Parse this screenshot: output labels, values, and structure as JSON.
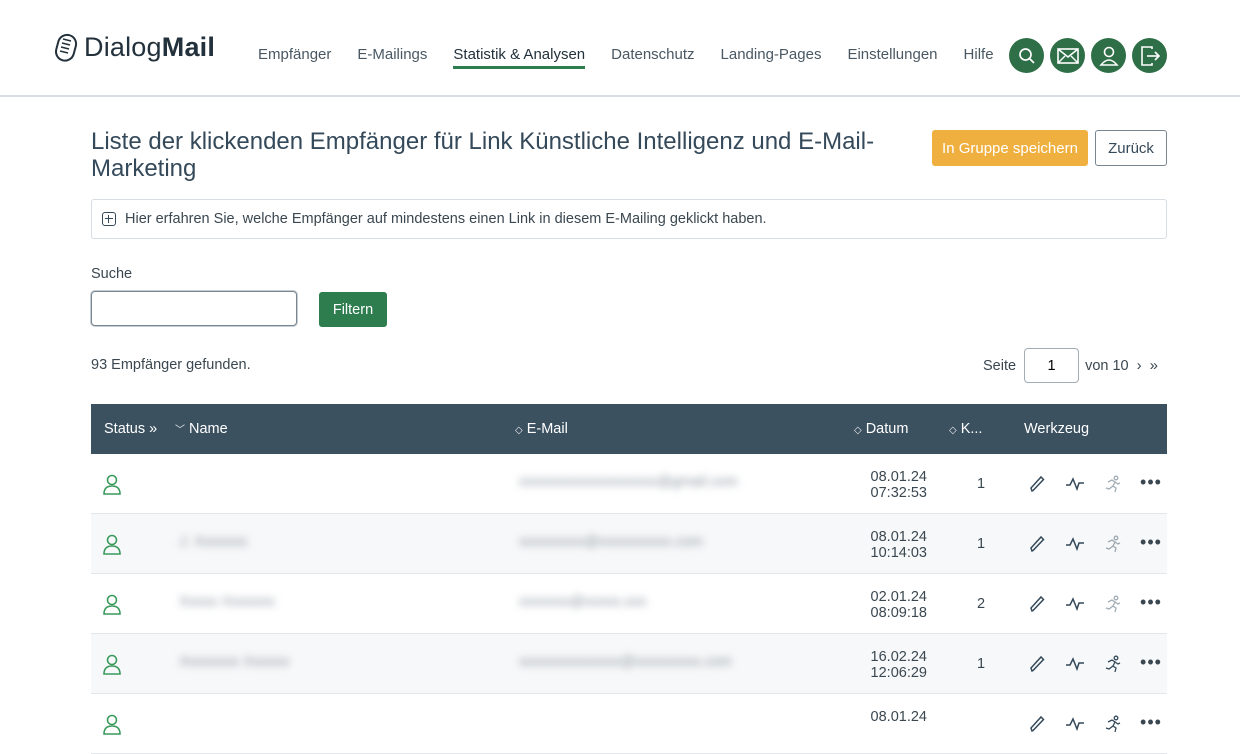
{
  "brand": {
    "logo_prefix": "Dialog",
    "logo_bold": "Mail"
  },
  "nav": [
    {
      "label": "Empfänger"
    },
    {
      "label": "E-Mailings"
    },
    {
      "label": "Statistik & Analysen",
      "active": true
    },
    {
      "label": "Datenschutz"
    },
    {
      "label": "Landing-Pages"
    },
    {
      "label": "Einstellungen"
    },
    {
      "label": "Hilfe"
    }
  ],
  "header_icons": [
    "search-icon",
    "mail-icon",
    "user-icon",
    "logout-icon"
  ],
  "page": {
    "title": "Liste der klickenden Empfänger für Link Künstliche Intelligenz und E-Mail-Marketing",
    "save_button": "In Gruppe speichern",
    "back_button": "Zurück",
    "info_text": "Hier erfahren Sie, welche Empfänger auf mindestens einen Link in diesem E-Mailing geklickt haben."
  },
  "search": {
    "label": "Suche",
    "value": "",
    "placeholder": "",
    "filter_button": "Filtern"
  },
  "results": {
    "found_text": "93 Empfänger gefunden."
  },
  "pager": {
    "page_label": "Seite",
    "current_page": "1",
    "of_label": "von 10",
    "next": "›",
    "last": "»"
  },
  "table": {
    "columns": {
      "status": "Status",
      "status_arrows": "»",
      "name": "Name",
      "email": "E-Mail",
      "date": "Datum",
      "count": "K...",
      "tools": "Werkzeug"
    },
    "rows": [
      {
        "name": "",
        "email": "xxxxxxxxxxxxxxxxxxx@gmail.com",
        "date": "08.01.24",
        "time": "07:32:53",
        "count": "1",
        "run_active": false
      },
      {
        "name": "J. Xxxxxxx",
        "email": "xxxxxxxxx@xxxxxxxxxx.com",
        "date": "08.01.24",
        "time": "10:14:03",
        "count": "1",
        "run_active": false
      },
      {
        "name": "Xxxxx Xxxxxxx",
        "email": "xxxxxxx@xxxxx.xxx",
        "date": "02.01.24",
        "time": "08:09:18",
        "count": "2",
        "run_active": false
      },
      {
        "name": "Xxxxxxxx Xxxxxx",
        "email": "xxxxxxxxxxxxxx@xxxxxxxxx.com",
        "date": "16.02.24",
        "time": "12:06:29",
        "count": "1",
        "run_active": true
      },
      {
        "name": "",
        "email": "",
        "date": "08.01.24",
        "time": "",
        "count": "",
        "run_active": true
      }
    ]
  },
  "colors": {
    "primary_green": "#2e7d4f",
    "header_bar": "#3b5160",
    "accent_orange": "#f0b03f"
  }
}
